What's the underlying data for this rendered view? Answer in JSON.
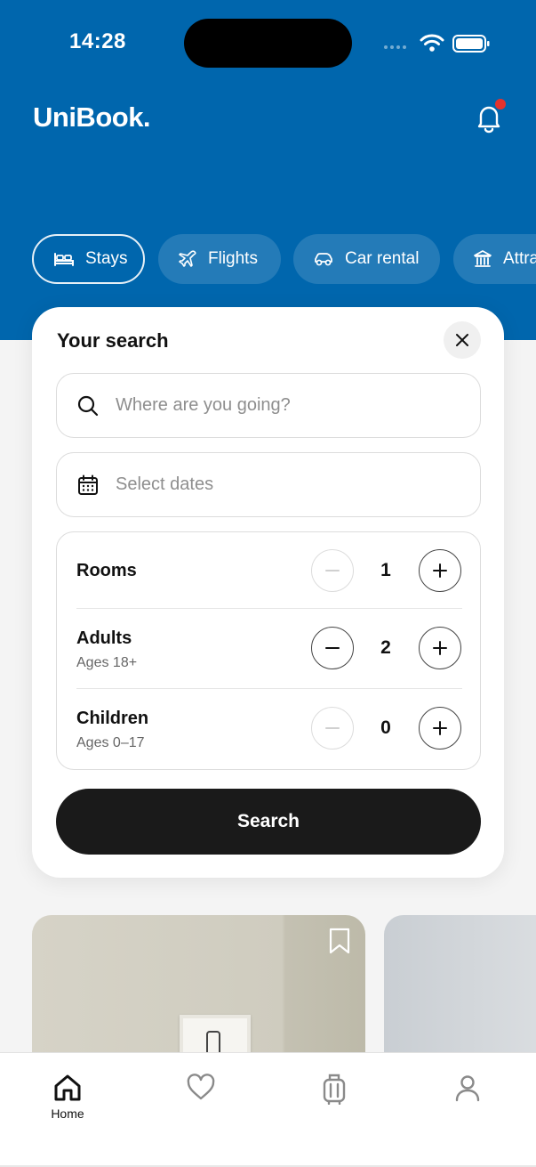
{
  "status_bar": {
    "time": "14:28"
  },
  "header": {
    "logo": "UniBook."
  },
  "tabs": [
    {
      "label": "Stays",
      "icon": "bed-icon",
      "active": true
    },
    {
      "label": "Flights",
      "icon": "plane-icon",
      "active": false
    },
    {
      "label": "Car rental",
      "icon": "car-icon",
      "active": false
    },
    {
      "label": "Attra",
      "icon": "museum-icon",
      "active": false
    }
  ],
  "search_card": {
    "title": "Your search",
    "destination_placeholder": "Where are you going?",
    "dates_placeholder": "Select dates",
    "counters": [
      {
        "label": "Rooms",
        "sublabel": "",
        "value": "1"
      },
      {
        "label": "Adults",
        "sublabel": "Ages 18+",
        "value": "2"
      },
      {
        "label": "Children",
        "sublabel": "Ages 0–17",
        "value": "0"
      }
    ],
    "search_button": "Search"
  },
  "bottom_nav": {
    "items": [
      {
        "label": "Home",
        "icon": "home-icon",
        "active": true
      },
      {
        "label": "",
        "icon": "heart-icon",
        "active": false
      },
      {
        "label": "",
        "icon": "luggage-icon",
        "active": false
      },
      {
        "label": "",
        "icon": "user-icon",
        "active": false
      }
    ]
  },
  "colors": {
    "header_bg": "#0066ad",
    "primary_button": "#1a1a1a",
    "notification_dot": "#e5322d"
  }
}
